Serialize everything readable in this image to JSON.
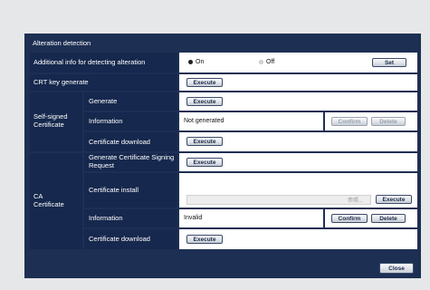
{
  "window": {
    "title": "Alteration detection"
  },
  "alteration": {
    "label": "Additional info for detecting alteration",
    "option_on": "On",
    "option_off": "Off",
    "selected": "On",
    "set_label": "Set"
  },
  "crt": {
    "label": "CRT key generate",
    "execute_label": "Execute"
  },
  "self_signed": {
    "group_label": "Self-signed Certificate",
    "generate": {
      "label": "Generate",
      "execute_label": "Execute"
    },
    "information": {
      "label": "Information",
      "value": "Not generated",
      "confirm_label": "Confirm",
      "delete_label": "Delete"
    },
    "download": {
      "label": "Certificate download",
      "execute_label": "Execute"
    }
  },
  "ca": {
    "group_label": "CA Certificate",
    "csr": {
      "label": "Generate Certificate Signing Request",
      "execute_label": "Execute"
    },
    "install": {
      "label": "Certificate install",
      "browse_label": "参照...",
      "execute_label": "Execute"
    },
    "information": {
      "label": "Information",
      "value": "Invalid",
      "confirm_label": "Confirm",
      "delete_label": "Delete"
    },
    "download": {
      "label": "Certificate download",
      "execute_label": "Execute"
    }
  },
  "footer": {
    "close_label": "Close"
  }
}
